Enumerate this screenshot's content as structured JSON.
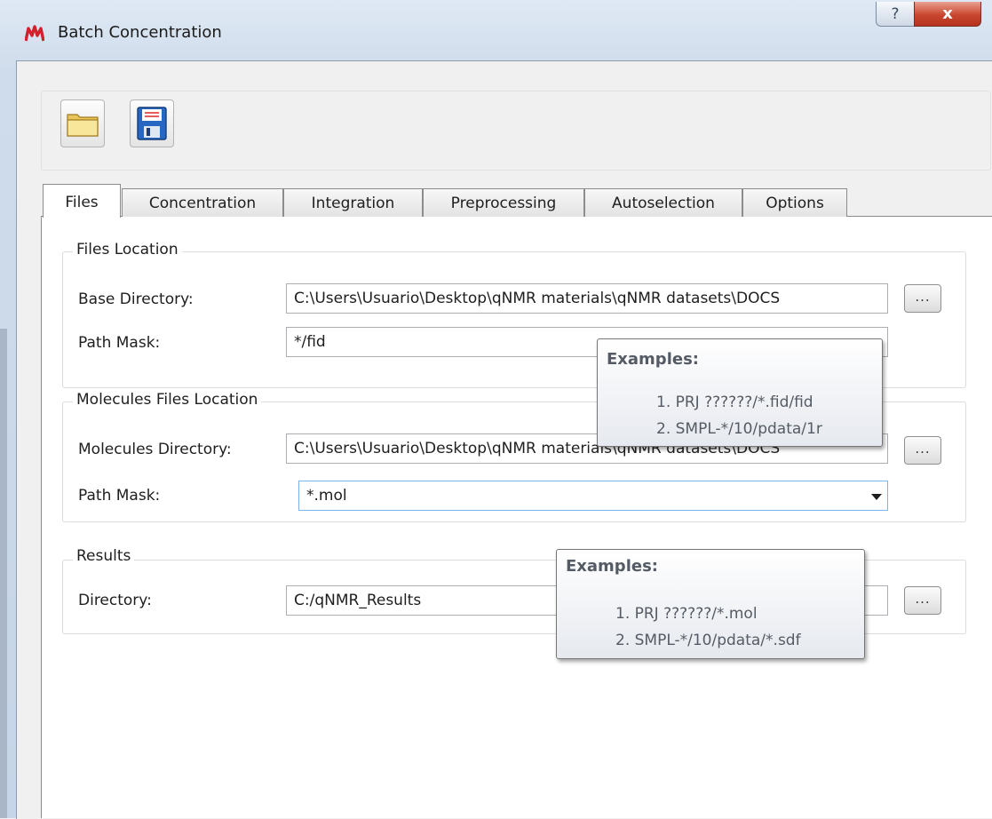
{
  "window": {
    "title": "Batch Concentration",
    "help_glyph": "?",
    "close_glyph": "x",
    "app_icon": "mnova-logo-icon"
  },
  "toolbar": {
    "open_icon": "folder-open-icon",
    "save_icon": "floppy-save-icon"
  },
  "tabs": [
    {
      "label": "Files",
      "active": true
    },
    {
      "label": "Concentration",
      "active": false
    },
    {
      "label": "Integration",
      "active": false
    },
    {
      "label": "Preprocessing",
      "active": false
    },
    {
      "label": "Autoselection",
      "active": false
    },
    {
      "label": "Options",
      "active": false
    }
  ],
  "files_location": {
    "title": "Files Location",
    "base_dir_label": "Base Directory:",
    "base_dir_value": "C:\\Users\\Usuario\\Desktop\\qNMR materials\\qNMR datasets\\DOCS",
    "path_mask_label": "Path Mask:",
    "path_mask_value": "*/fid",
    "browse_label": "..."
  },
  "molecules_location": {
    "title": "Molecules Files Location",
    "dir_label": "Molecules Directory:",
    "dir_value": "C:\\Users\\Usuario\\Desktop\\qNMR materials\\qNMR datasets\\DOCS",
    "path_mask_label": "Path Mask:",
    "path_mask_value": "*.mol",
    "browse_label": "..."
  },
  "results": {
    "title": "Results",
    "dir_label": "Directory:",
    "dir_value": "C:/qNMR_Results",
    "browse_label": "..."
  },
  "tooltip_files": {
    "heading": "Examples:",
    "line1": "1. PRJ ??????/*.fid/fid",
    "line2": "2. SMPL-*/10/pdata/1r"
  },
  "tooltip_molecules": {
    "heading": "Examples:",
    "line1": "1. PRJ ??????/*.mol",
    "line2": "2. SMPL-*/10/pdata/*.sdf"
  },
  "colors": {
    "title_bar": "#cfdceb",
    "close_button": "#c9452e",
    "combo_focus_border": "#7eb4ea"
  }
}
